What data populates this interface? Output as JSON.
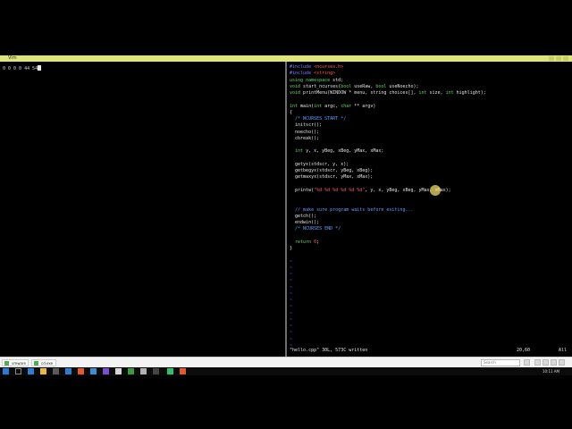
{
  "window": {
    "title": "Vim"
  },
  "left_pane": {
    "output": "0 0 0 0 44 54"
  },
  "code_lines": [
    [
      {
        "t": "#include ",
        "c": "pp"
      },
      {
        "t": "<ncurses.h>",
        "c": "inc"
      }
    ],
    [
      {
        "t": "#include ",
        "c": "pp"
      },
      {
        "t": "<string>",
        "c": "inc"
      }
    ],
    [
      {
        "t": "using ",
        "c": "kw"
      },
      {
        "t": "namespace",
        "c": "kw"
      },
      {
        "t": " std;"
      }
    ],
    [
      {
        "t": "void",
        "c": "ty"
      },
      {
        "t": " start_ncurses("
      },
      {
        "t": "bool",
        "c": "ty"
      },
      {
        "t": " useRaw, "
      },
      {
        "t": "bool",
        "c": "ty"
      },
      {
        "t": " useNoecho);"
      }
    ],
    [
      {
        "t": "void",
        "c": "ty"
      },
      {
        "t": " printMenu(WINDOW * menu, string choices[], "
      },
      {
        "t": "int",
        "c": "ty"
      },
      {
        "t": " size, "
      },
      {
        "t": "int",
        "c": "ty"
      },
      {
        "t": " highlight);"
      }
    ],
    [],
    [
      {
        "t": "int",
        "c": "ty"
      },
      {
        "t": " main("
      },
      {
        "t": "int",
        "c": "ty"
      },
      {
        "t": " argc, "
      },
      {
        "t": "char",
        "c": "ty"
      },
      {
        "t": " ** argv)"
      }
    ],
    [
      {
        "t": "{"
      }
    ],
    [
      {
        "t": "  "
      },
      {
        "t": "/* NCURSES START */",
        "c": "cm"
      }
    ],
    [
      {
        "t": "  initscr();"
      }
    ],
    [
      {
        "t": "  noecho();"
      }
    ],
    [
      {
        "t": "  cbreak();"
      }
    ],
    [],
    [
      {
        "t": "  "
      },
      {
        "t": "int",
        "c": "ty"
      },
      {
        "t": " y, x, yBeg, xBeg, yMax, xMax;"
      }
    ],
    [],
    [
      {
        "t": "  getyx(stdscr, y, x);"
      }
    ],
    [
      {
        "t": "  getbegyx(stdscr, yBeg, xBeg);"
      }
    ],
    [
      {
        "t": "  getmaxyx(stdscr, yMax, xMax);"
      }
    ],
    [],
    [
      {
        "t": "  printw("
      },
      {
        "t": "\"%d %d %d %d %d %d\"",
        "c": "st"
      },
      {
        "t": ", y, x, yBeg, xBeg, yMax, xMax);"
      }
    ],
    [],
    [],
    [
      {
        "t": "  "
      },
      {
        "t": "// make sure program waits before exiting...",
        "c": "cm"
      }
    ],
    [
      {
        "t": "  getch();"
      }
    ],
    [
      {
        "t": "  endwin();"
      }
    ],
    [
      {
        "t": "  "
      },
      {
        "t": "/* NCURSES END */",
        "c": "cm"
      }
    ],
    [],
    [
      {
        "t": "  "
      },
      {
        "t": "return",
        "c": "kw"
      },
      {
        "t": " "
      },
      {
        "t": "0",
        "c": "nm"
      },
      {
        "t": ";"
      }
    ],
    [
      {
        "t": "}"
      }
    ],
    [],
    [
      {
        "t": "~",
        "c": "tl"
      }
    ],
    [
      {
        "t": "~",
        "c": "tl"
      }
    ],
    [
      {
        "t": "~",
        "c": "tl"
      }
    ],
    [
      {
        "t": "~",
        "c": "tl"
      }
    ],
    [
      {
        "t": "~",
        "c": "tl"
      }
    ],
    [
      {
        "t": "~",
        "c": "tl"
      }
    ],
    [
      {
        "t": "~",
        "c": "tl"
      }
    ],
    [
      {
        "t": "~",
        "c": "tl"
      }
    ],
    [
      {
        "t": "~",
        "c": "tl"
      }
    ],
    [
      {
        "t": "~",
        "c": "tl"
      }
    ],
    [
      {
        "t": "~",
        "c": "tl"
      }
    ],
    [
      {
        "t": "~",
        "c": "tl"
      }
    ],
    [
      {
        "t": "~",
        "c": "tl"
      }
    ],
    [
      {
        "t": "~",
        "c": "tl"
      }
    ]
  ],
  "status": {
    "message": "\"hello.cpp\" 30L, 573C written",
    "position": "20,60",
    "scroll": "All"
  },
  "tabs": [
    {
      "label": "vmware"
    },
    {
      "label": "cd.exe"
    }
  ],
  "search": {
    "placeholder": "Search"
  },
  "taskbar": {
    "clock": "10:11 AM"
  },
  "colors": {
    "titlebar": "#dfe37a",
    "comment": "#5aa0ff",
    "string": "#ff5a5a",
    "keyword": "#62d862",
    "preproc": "#7b7bff"
  }
}
